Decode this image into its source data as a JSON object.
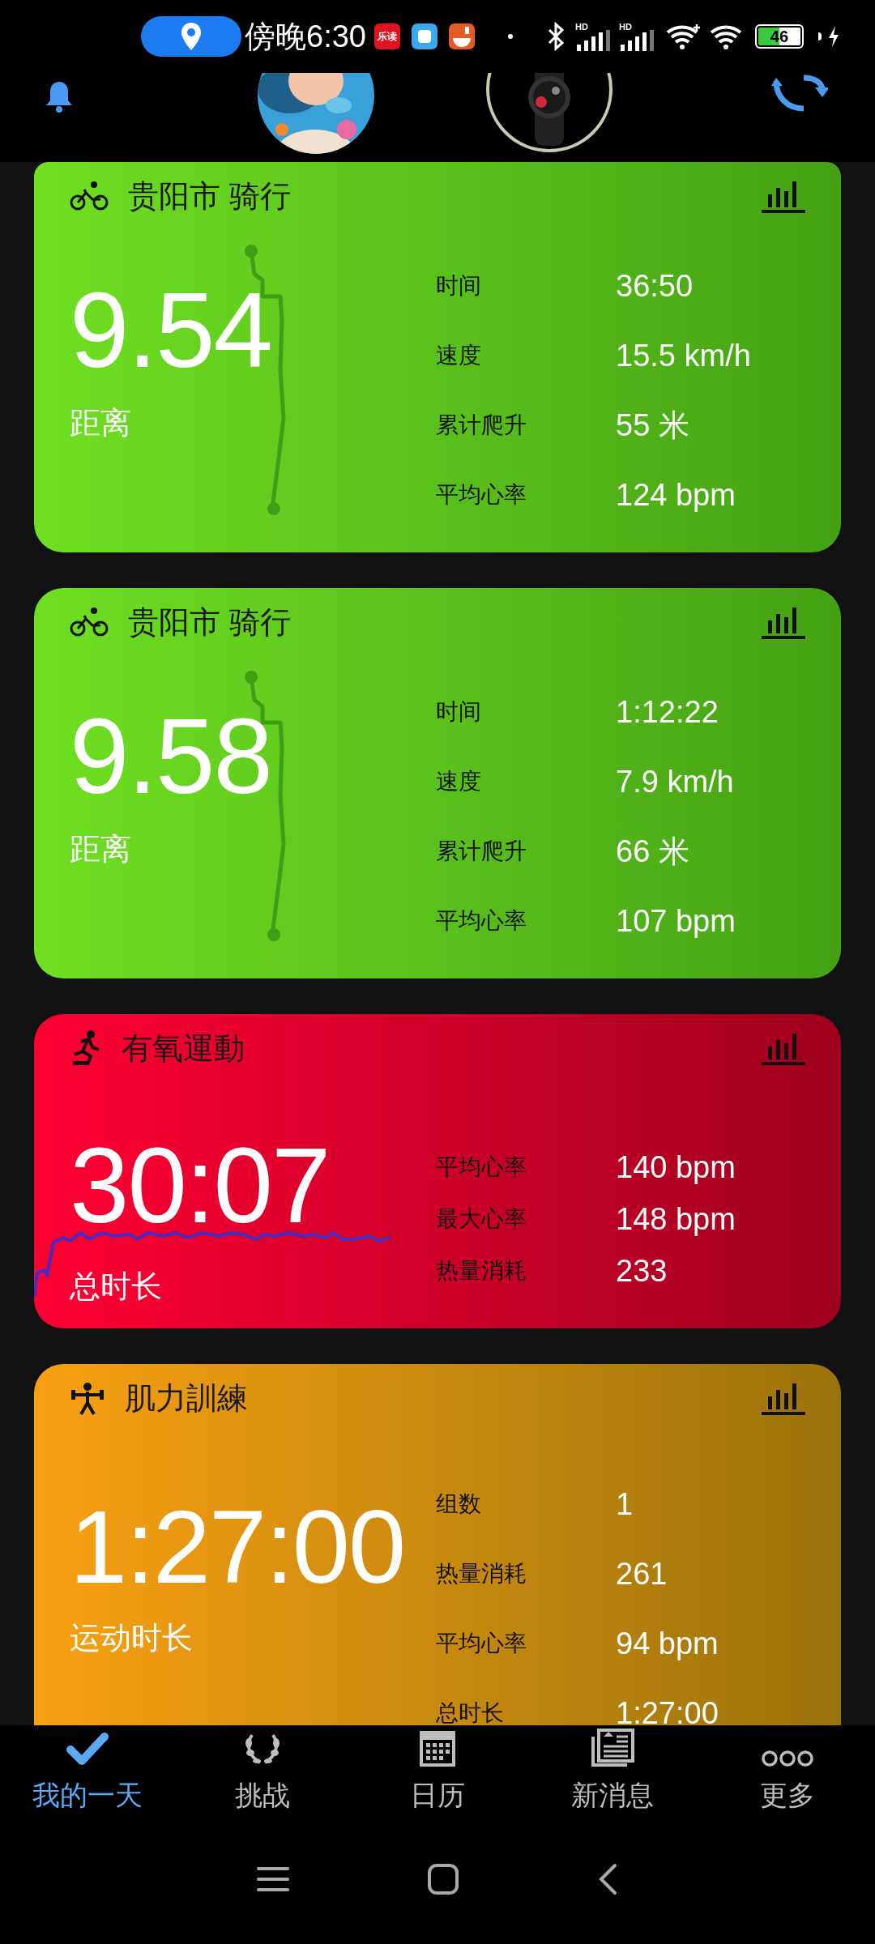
{
  "status_bar": {
    "time": "傍晚6:30",
    "app_badge": "乐读",
    "network_labels": [
      "HD",
      "HD"
    ],
    "battery": "46"
  },
  "activities": [
    {
      "kind": "cycling",
      "title": "贵阳市 骑行",
      "color": "#6fe022",
      "main_value": "9.54",
      "main_label": "距离",
      "stats": [
        {
          "label": "时间",
          "value": "36:50"
        },
        {
          "label": "速度",
          "value": "15.5 km/h"
        },
        {
          "label": "累计爬升",
          "value": "55 米"
        },
        {
          "label": "平均心率",
          "value": "124 bpm"
        }
      ]
    },
    {
      "kind": "cycling",
      "title": "贵阳市 骑行",
      "color": "#6fe022",
      "main_value": "9.58",
      "main_label": "距离",
      "stats": [
        {
          "label": "时间",
          "value": "1:12:22"
        },
        {
          "label": "速度",
          "value": "7.9 km/h"
        },
        {
          "label": "累计爬升",
          "value": "66 米"
        },
        {
          "label": "平均心率",
          "value": "107 bpm"
        }
      ]
    },
    {
      "kind": "cardio",
      "title": "有氧運動",
      "color": "#ff0033",
      "main_value": "30:07",
      "main_label": "总时长",
      "stats": [
        {
          "label": "平均心率",
          "value": "140 bpm"
        },
        {
          "label": "最大心率",
          "value": "148 bpm"
        },
        {
          "label": "热量消耗",
          "value": "233"
        }
      ]
    },
    {
      "kind": "strength",
      "title": "肌力訓練",
      "color": "#f9a012",
      "main_value": "1:27:00",
      "main_label": "运动时长",
      "stats": [
        {
          "label": "组数",
          "value": "1"
        },
        {
          "label": "热量消耗",
          "value": "261"
        },
        {
          "label": "平均心率",
          "value": "94 bpm"
        },
        {
          "label": "总时长",
          "value": "1:27:00"
        }
      ]
    }
  ],
  "nav": [
    {
      "label": "我的一天",
      "selected": true
    },
    {
      "label": "挑战",
      "selected": false
    },
    {
      "label": "日历",
      "selected": false
    },
    {
      "label": "新消息",
      "selected": false
    },
    {
      "label": "更多",
      "selected": false
    }
  ]
}
